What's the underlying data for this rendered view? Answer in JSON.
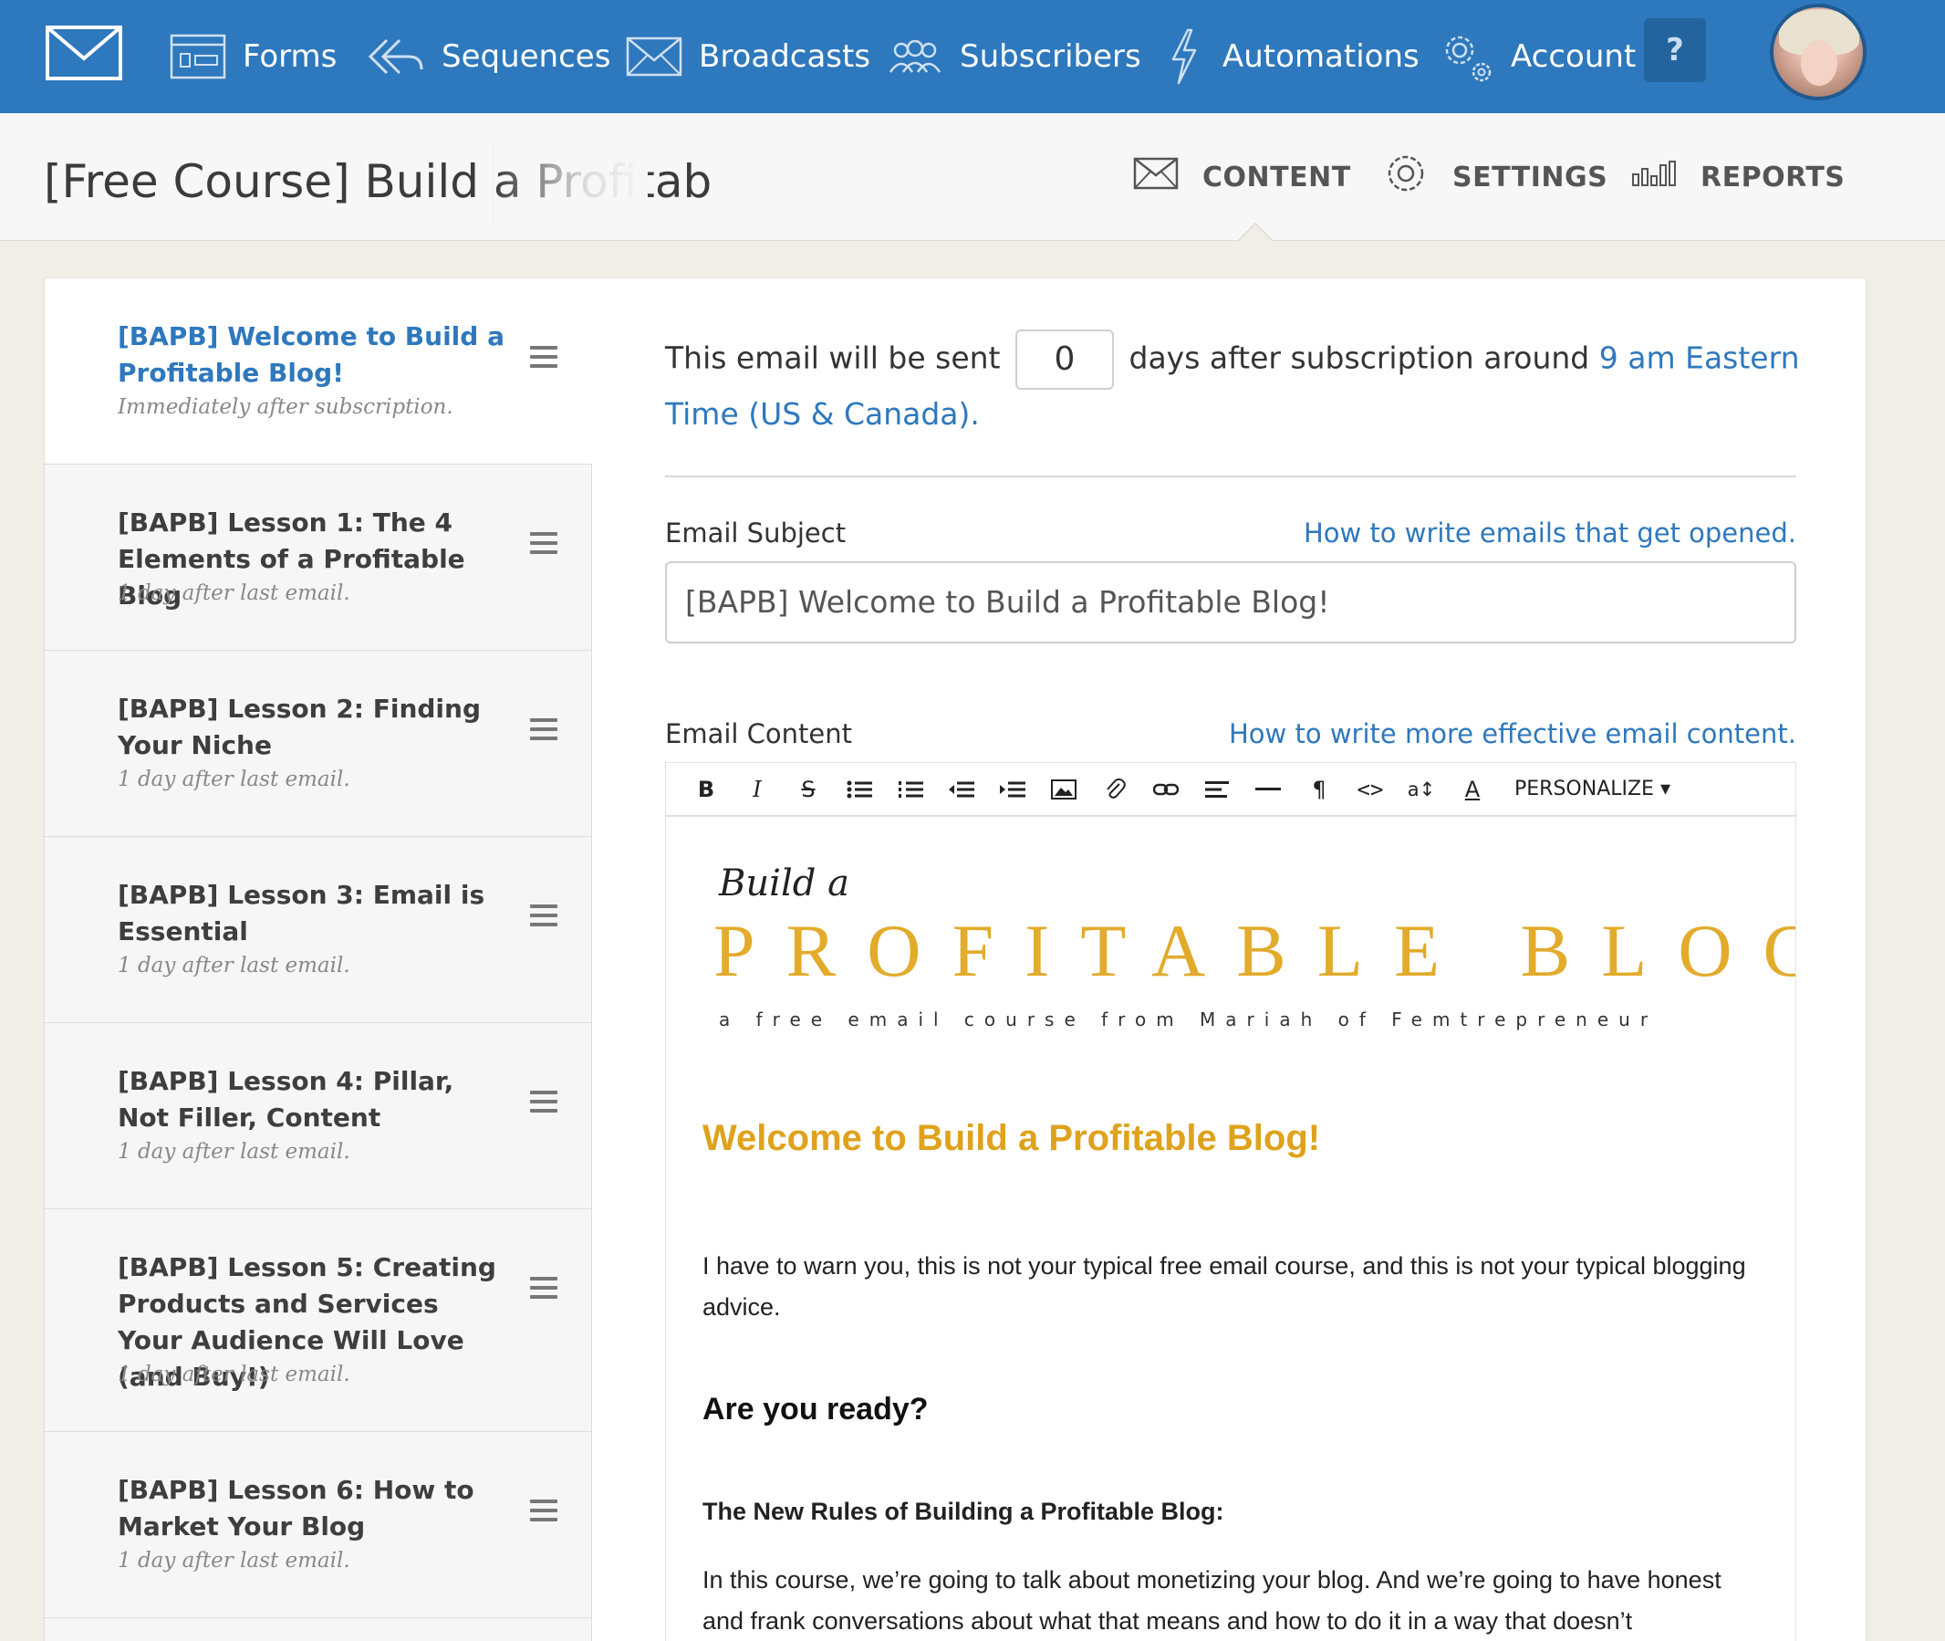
{
  "nav": {
    "items": [
      {
        "label": "Forms",
        "icon": "forms-icon"
      },
      {
        "label": "Sequences",
        "icon": "sequences-icon"
      },
      {
        "label": "Broadcasts",
        "icon": "broadcasts-icon"
      },
      {
        "label": "Subscribers",
        "icon": "subscribers-icon"
      },
      {
        "label": "Automations",
        "icon": "automations-icon"
      },
      {
        "label": "Account",
        "icon": "account-gear-icon"
      }
    ],
    "help_label": "?"
  },
  "header": {
    "title": "[Free Course] Build a Profitab",
    "tabs": [
      {
        "label": "CONTENT",
        "icon": "envelope-icon"
      },
      {
        "label": "SETTINGS",
        "icon": "gear-icon"
      },
      {
        "label": "REPORTS",
        "icon": "bar-chart-icon"
      }
    ]
  },
  "sequence_emails": [
    {
      "title": "[BAPB] Welcome to Build a Profitable Blog!",
      "delay": "Immediately after subscription."
    },
    {
      "title": "[BAPB] Lesson 1: The 4 Elements of a Profitable Blog",
      "delay": "1 day after last email."
    },
    {
      "title": "[BAPB] Lesson 2: Finding Your Niche",
      "delay": "1 day after last email."
    },
    {
      "title": "[BAPB] Lesson 3: Email is Essential",
      "delay": "1 day after last email."
    },
    {
      "title": "[BAPB] Lesson 4: Pillar, Not Filler, Content",
      "delay": "1 day after last email."
    },
    {
      "title": "[BAPB] Lesson 5: Creating Products and Services Your Audience Will Love (and Buy!)",
      "delay": "1 day after last email."
    },
    {
      "title": "[BAPB] Lesson 6: How to Market Your Blog",
      "delay": "1 day after last email."
    }
  ],
  "editor": {
    "send_prefix": "This email will be sent",
    "days_value": "0",
    "send_middle": "days after subscription around",
    "send_time_link": "9 am Eastern Time (US & Canada).",
    "subject_label": "Email Subject",
    "subject_help": "How to write emails that get opened.",
    "subject_value": "[BAPB] Welcome to Build a Profitable Blog!",
    "content_label": "Email Content",
    "content_help": "How to write more effective email content.",
    "toolbar": {
      "buttons": [
        "bold",
        "italic",
        "strikethrough",
        "bullet-list",
        "numbered-list",
        "outdent",
        "indent",
        "image",
        "attachment",
        "link",
        "align",
        "horizontal-rule",
        "paragraph",
        "code",
        "font-size",
        "text-color"
      ],
      "personalize_label": "PERSONALIZE"
    }
  },
  "email_body": {
    "banner_script": "Build a",
    "banner_title": "PROFITABLE BLOG",
    "banner_subtitle": "a free email course from Mariah of Femtrepreneur",
    "heading": "Welcome to Build a Profitable Blog!",
    "intro": "I have to warn you, this is not your typical free email course, and this is not your typical blogging advice.",
    "subheading": "Are you ready?",
    "rules_heading": "The New Rules of Building a Profitable Blog:",
    "paragraph": "In this course, we’re going to talk about monetizing your blog. And we’re going to have honest and frank conversations about what that means and how to do it in a way that doesn’t"
  },
  "colors": {
    "nav_bg": "#2e78bd",
    "link": "#2e78bd",
    "accent_gold": "#dfa21c",
    "page_bg": "#f1eee8"
  }
}
